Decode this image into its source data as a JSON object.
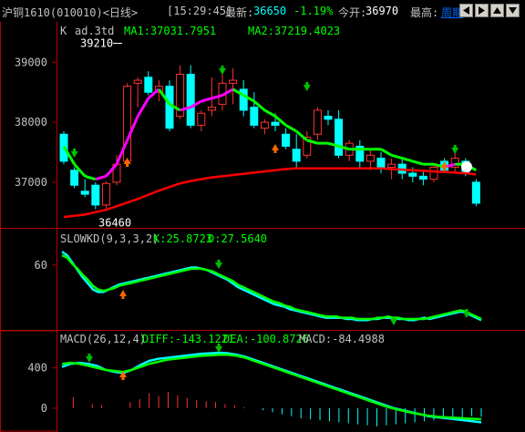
{
  "topbar": {
    "contract": "沪铜1610(010010)<日线>",
    "time": "[15:29:45]",
    "last_label": "最新:",
    "last_value": "36650",
    "change": "-1.19%",
    "open_label": "今开:",
    "open_value": "36970",
    "high_label": "最高:",
    "period": "周期",
    "nav_icons": [
      "arrow-left-icon",
      "arrow-right-icon",
      "arrow-up-icon",
      "arrow-down-icon"
    ]
  },
  "main_panel": {
    "header_k": "K",
    "header_name": "ad.3td",
    "ma1": "MA1:37031.7951",
    "ma2": "MA2:37219.4023",
    "high_mark": "39210",
    "low_mark": "36460",
    "y_ticks": [
      "39000",
      "38000",
      "37000"
    ]
  },
  "kd_panel": {
    "name": "SLOWKD(9,3,3,2)",
    "k": "K:25.8723",
    "d": "D:27.5640",
    "y_ticks": [
      "60"
    ]
  },
  "macd_panel": {
    "name": "MACD(26,12,4)",
    "diff": "DIFF:-143.1221",
    "dea": "DEA:-100.8726",
    "macd": "MACD:-84.4988",
    "y_ticks": [
      "400",
      "0"
    ]
  },
  "colors": {
    "up": "#ff3232",
    "down": "#00ffff",
    "ma1": "#00ff00",
    "ma1_alt": "#ff00ff",
    "ma2": "#ff0000",
    "axis": "#b00000",
    "diff": "#00ffff",
    "dea": "#00ff00",
    "diff_alt": "#ff00ff"
  },
  "chart_data": [
    {
      "type": "candlestick",
      "title": "ad.3td",
      "x_count": 40,
      "candles": [
        [
          37800,
          37850,
          37300,
          37350
        ],
        [
          37200,
          37250,
          36900,
          36950
        ],
        [
          36850,
          37050,
          36750,
          36800
        ],
        [
          36950,
          37000,
          36550,
          36620
        ],
        [
          36620,
          37020,
          36550,
          36980
        ],
        [
          37000,
          37450,
          36950,
          37300
        ],
        [
          37350,
          38650,
          37300,
          38600
        ],
        [
          38650,
          38750,
          38250,
          38700
        ],
        [
          38750,
          38850,
          38450,
          38500
        ],
        [
          38500,
          38700,
          38350,
          38600
        ],
        [
          38600,
          38700,
          37850,
          37900
        ],
        [
          38100,
          38950,
          38050,
          38800
        ],
        [
          38800,
          38950,
          37900,
          37950
        ],
        [
          37950,
          38200,
          37850,
          38150
        ],
        [
          38200,
          38750,
          38100,
          38250
        ],
        [
          38300,
          38800,
          38200,
          38650
        ],
        [
          38650,
          38900,
          38300,
          38700
        ],
        [
          38550,
          38700,
          38100,
          38200
        ],
        [
          38250,
          38500,
          37900,
          37950
        ],
        [
          37900,
          38050,
          37800,
          38000
        ],
        [
          38000,
          38150,
          37850,
          37950
        ],
        [
          37800,
          37900,
          37550,
          37600
        ],
        [
          37550,
          37800,
          37250,
          37350
        ],
        [
          37450,
          37850,
          37400,
          37750
        ],
        [
          37800,
          38250,
          37700,
          38200
        ],
        [
          38100,
          38200,
          37950,
          38050
        ],
        [
          38050,
          38200,
          37400,
          37450
        ],
        [
          37450,
          37700,
          37350,
          37650
        ],
        [
          37600,
          37700,
          37250,
          37350
        ],
        [
          37350,
          37550,
          37200,
          37450
        ],
        [
          37400,
          37500,
          37150,
          37250
        ],
        [
          37250,
          37400,
          37050,
          37300
        ],
        [
          37300,
          37400,
          37050,
          37150
        ],
        [
          37150,
          37250,
          37000,
          37100
        ],
        [
          37100,
          37200,
          36950,
          37050
        ],
        [
          37050,
          37300,
          37000,
          37250
        ],
        [
          37350,
          37400,
          37150,
          37200
        ],
        [
          37250,
          37500,
          37150,
          37400
        ],
        [
          37350,
          37400,
          37100,
          37150
        ],
        [
          37000,
          37050,
          36600,
          36650
        ]
      ],
      "ma1_values": [
        37600,
        37300,
        37100,
        37050,
        37100,
        37300,
        37700,
        38100,
        38400,
        38550,
        38300,
        38200,
        38250,
        38350,
        38400,
        38450,
        38550,
        38450,
        38350,
        38200,
        38100,
        37950,
        37850,
        37700,
        37650,
        37650,
        37600,
        37550,
        37550,
        37550,
        37550,
        37450,
        37400,
        37350,
        37300,
        37300,
        37250,
        37300,
        37300,
        37200
      ],
      "ma2_values": [
        36420,
        36440,
        36460,
        36500,
        36540,
        36600,
        36660,
        36720,
        36790,
        36860,
        36920,
        36980,
        37020,
        37050,
        37080,
        37100,
        37120,
        37140,
        37160,
        37180,
        37200,
        37220,
        37230,
        37230,
        37230,
        37230,
        37230,
        37230,
        37230,
        37230,
        37230,
        37220,
        37210,
        37200,
        37190,
        37180,
        37170,
        37160,
        37150,
        37130
      ],
      "ylim": [
        36300,
        39400
      ],
      "y_ticks": [
        37000,
        38000,
        39000
      ]
    },
    {
      "type": "line",
      "title": "SLOWKD(9,3,3,2)",
      "series": [
        {
          "name": "K",
          "values": [
            71,
            68,
            62,
            56,
            50,
            45,
            40,
            38,
            38,
            40,
            42,
            44,
            45,
            46,
            47,
            48,
            49,
            50,
            51,
            52,
            53,
            54,
            55,
            56,
            57,
            58,
            58,
            57,
            56,
            54,
            52,
            50,
            48,
            45,
            42,
            40,
            38,
            36,
            34,
            32,
            30,
            28,
            27,
            26,
            24,
            23,
            22,
            21,
            20,
            19,
            18,
            17,
            17,
            17,
            17,
            16,
            16,
            15,
            15,
            15,
            16,
            16,
            17,
            17,
            17,
            16,
            16,
            15,
            15,
            16,
            17,
            16,
            17,
            18,
            19,
            20,
            21,
            22,
            21,
            19,
            17,
            15
          ]
        },
        {
          "name": "D",
          "values": [
            68,
            66,
            61,
            57,
            52,
            48,
            43,
            40,
            39,
            40,
            41,
            43,
            44,
            45,
            46,
            47,
            48,
            49,
            50,
            51,
            52,
            53,
            54,
            55,
            56,
            57,
            57,
            57,
            56,
            55,
            53,
            51,
            49,
            47,
            44,
            42,
            40,
            38,
            36,
            34,
            32,
            30,
            29,
            27,
            26,
            24,
            23,
            22,
            21,
            20,
            19,
            18,
            18,
            18,
            17,
            17,
            17,
            16,
            16,
            16,
            16,
            17,
            17,
            18,
            17,
            17,
            16,
            16,
            16,
            16,
            16,
            17,
            18,
            19,
            20,
            21,
            22,
            23,
            22,
            20,
            18,
            16
          ]
        }
      ],
      "ylim": [
        10,
        80
      ],
      "y_ticks": [
        60
      ]
    },
    {
      "type": "line",
      "title": "MACD(26,12,4)",
      "series": [
        {
          "name": "DIFF",
          "values": [
            410,
            440,
            450,
            440,
            420,
            380,
            360,
            350,
            380,
            430,
            470,
            490,
            500,
            510,
            520,
            530,
            540,
            545,
            550,
            545,
            530,
            510,
            480,
            450,
            420,
            390,
            360,
            330,
            300,
            270,
            240,
            210,
            180,
            150,
            120,
            90,
            60,
            30,
            0,
            -20,
            -40,
            -60,
            -80,
            -90,
            -100,
            -110,
            -120,
            -130,
            -140
          ]
        },
        {
          "name": "DEA",
          "values": [
            440,
            450,
            440,
            420,
            400,
            380,
            370,
            360,
            380,
            410,
            440,
            460,
            480,
            490,
            500,
            510,
            520,
            525,
            530,
            530,
            520,
            500,
            470,
            440,
            410,
            380,
            350,
            320,
            290,
            260,
            230,
            200,
            170,
            140,
            110,
            80,
            50,
            20,
            -5,
            -25,
            -45,
            -60,
            -75,
            -85,
            -90,
            -95,
            -100,
            -105,
            -110
          ]
        }
      ],
      "bars": [
        0,
        110,
        0,
        40,
        30,
        0,
        0,
        60,
        90,
        150,
        120,
        160,
        130,
        100,
        80,
        70,
        60,
        40,
        30,
        10,
        0,
        -20,
        -40,
        -60,
        -80,
        -100,
        -110,
        -120,
        -130,
        -140,
        -150,
        -160,
        -170,
        -180,
        -170,
        -160,
        -150,
        -140,
        -130,
        -120,
        -110,
        -100,
        -90,
        -80,
        -85
      ],
      "ylim": [
        -200,
        650
      ],
      "y_ticks": [
        0,
        400
      ]
    }
  ]
}
